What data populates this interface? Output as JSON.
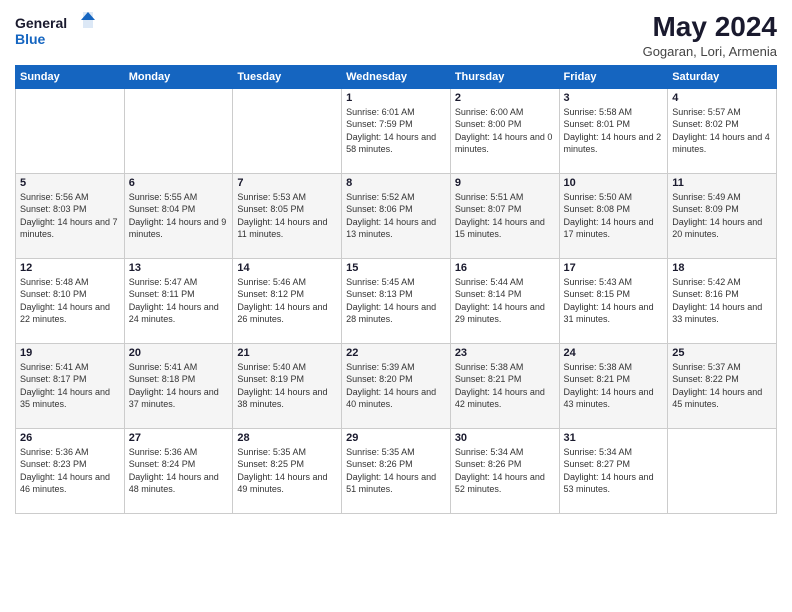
{
  "logo": {
    "line1": "General",
    "line2": "Blue"
  },
  "title": "May 2024",
  "subtitle": "Gogaran, Lori, Armenia",
  "weekdays": [
    "Sunday",
    "Monday",
    "Tuesday",
    "Wednesday",
    "Thursday",
    "Friday",
    "Saturday"
  ],
  "weeks": [
    [
      {
        "day": "",
        "sunrise": "",
        "sunset": "",
        "daylight": ""
      },
      {
        "day": "",
        "sunrise": "",
        "sunset": "",
        "daylight": ""
      },
      {
        "day": "",
        "sunrise": "",
        "sunset": "",
        "daylight": ""
      },
      {
        "day": "1",
        "sunrise": "Sunrise: 6:01 AM",
        "sunset": "Sunset: 7:59 PM",
        "daylight": "Daylight: 14 hours and 58 minutes."
      },
      {
        "day": "2",
        "sunrise": "Sunrise: 6:00 AM",
        "sunset": "Sunset: 8:00 PM",
        "daylight": "Daylight: 14 hours and 0 minutes."
      },
      {
        "day": "3",
        "sunrise": "Sunrise: 5:58 AM",
        "sunset": "Sunset: 8:01 PM",
        "daylight": "Daylight: 14 hours and 2 minutes."
      },
      {
        "day": "4",
        "sunrise": "Sunrise: 5:57 AM",
        "sunset": "Sunset: 8:02 PM",
        "daylight": "Daylight: 14 hours and 4 minutes."
      }
    ],
    [
      {
        "day": "5",
        "sunrise": "Sunrise: 5:56 AM",
        "sunset": "Sunset: 8:03 PM",
        "daylight": "Daylight: 14 hours and 7 minutes."
      },
      {
        "day": "6",
        "sunrise": "Sunrise: 5:55 AM",
        "sunset": "Sunset: 8:04 PM",
        "daylight": "Daylight: 14 hours and 9 minutes."
      },
      {
        "day": "7",
        "sunrise": "Sunrise: 5:53 AM",
        "sunset": "Sunset: 8:05 PM",
        "daylight": "Daylight: 14 hours and 11 minutes."
      },
      {
        "day": "8",
        "sunrise": "Sunrise: 5:52 AM",
        "sunset": "Sunset: 8:06 PM",
        "daylight": "Daylight: 14 hours and 13 minutes."
      },
      {
        "day": "9",
        "sunrise": "Sunrise: 5:51 AM",
        "sunset": "Sunset: 8:07 PM",
        "daylight": "Daylight: 14 hours and 15 minutes."
      },
      {
        "day": "10",
        "sunrise": "Sunrise: 5:50 AM",
        "sunset": "Sunset: 8:08 PM",
        "daylight": "Daylight: 14 hours and 17 minutes."
      },
      {
        "day": "11",
        "sunrise": "Sunrise: 5:49 AM",
        "sunset": "Sunset: 8:09 PM",
        "daylight": "Daylight: 14 hours and 20 minutes."
      }
    ],
    [
      {
        "day": "12",
        "sunrise": "Sunrise: 5:48 AM",
        "sunset": "Sunset: 8:10 PM",
        "daylight": "Daylight: 14 hours and 22 minutes."
      },
      {
        "day": "13",
        "sunrise": "Sunrise: 5:47 AM",
        "sunset": "Sunset: 8:11 PM",
        "daylight": "Daylight: 14 hours and 24 minutes."
      },
      {
        "day": "14",
        "sunrise": "Sunrise: 5:46 AM",
        "sunset": "Sunset: 8:12 PM",
        "daylight": "Daylight: 14 hours and 26 minutes."
      },
      {
        "day": "15",
        "sunrise": "Sunrise: 5:45 AM",
        "sunset": "Sunset: 8:13 PM",
        "daylight": "Daylight: 14 hours and 28 minutes."
      },
      {
        "day": "16",
        "sunrise": "Sunrise: 5:44 AM",
        "sunset": "Sunset: 8:14 PM",
        "daylight": "Daylight: 14 hours and 29 minutes."
      },
      {
        "day": "17",
        "sunrise": "Sunrise: 5:43 AM",
        "sunset": "Sunset: 8:15 PM",
        "daylight": "Daylight: 14 hours and 31 minutes."
      },
      {
        "day": "18",
        "sunrise": "Sunrise: 5:42 AM",
        "sunset": "Sunset: 8:16 PM",
        "daylight": "Daylight: 14 hours and 33 minutes."
      }
    ],
    [
      {
        "day": "19",
        "sunrise": "Sunrise: 5:41 AM",
        "sunset": "Sunset: 8:17 PM",
        "daylight": "Daylight: 14 hours and 35 minutes."
      },
      {
        "day": "20",
        "sunrise": "Sunrise: 5:41 AM",
        "sunset": "Sunset: 8:18 PM",
        "daylight": "Daylight: 14 hours and 37 minutes."
      },
      {
        "day": "21",
        "sunrise": "Sunrise: 5:40 AM",
        "sunset": "Sunset: 8:19 PM",
        "daylight": "Daylight: 14 hours and 38 minutes."
      },
      {
        "day": "22",
        "sunrise": "Sunrise: 5:39 AM",
        "sunset": "Sunset: 8:20 PM",
        "daylight": "Daylight: 14 hours and 40 minutes."
      },
      {
        "day": "23",
        "sunrise": "Sunrise: 5:38 AM",
        "sunset": "Sunset: 8:21 PM",
        "daylight": "Daylight: 14 hours and 42 minutes."
      },
      {
        "day": "24",
        "sunrise": "Sunrise: 5:38 AM",
        "sunset": "Sunset: 8:21 PM",
        "daylight": "Daylight: 14 hours and 43 minutes."
      },
      {
        "day": "25",
        "sunrise": "Sunrise: 5:37 AM",
        "sunset": "Sunset: 8:22 PM",
        "daylight": "Daylight: 14 hours and 45 minutes."
      }
    ],
    [
      {
        "day": "26",
        "sunrise": "Sunrise: 5:36 AM",
        "sunset": "Sunset: 8:23 PM",
        "daylight": "Daylight: 14 hours and 46 minutes."
      },
      {
        "day": "27",
        "sunrise": "Sunrise: 5:36 AM",
        "sunset": "Sunset: 8:24 PM",
        "daylight": "Daylight: 14 hours and 48 minutes."
      },
      {
        "day": "28",
        "sunrise": "Sunrise: 5:35 AM",
        "sunset": "Sunset: 8:25 PM",
        "daylight": "Daylight: 14 hours and 49 minutes."
      },
      {
        "day": "29",
        "sunrise": "Sunrise: 5:35 AM",
        "sunset": "Sunset: 8:26 PM",
        "daylight": "Daylight: 14 hours and 51 minutes."
      },
      {
        "day": "30",
        "sunrise": "Sunrise: 5:34 AM",
        "sunset": "Sunset: 8:26 PM",
        "daylight": "Daylight: 14 hours and 52 minutes."
      },
      {
        "day": "31",
        "sunrise": "Sunrise: 5:34 AM",
        "sunset": "Sunset: 8:27 PM",
        "daylight": "Daylight: 14 hours and 53 minutes."
      },
      {
        "day": "",
        "sunrise": "",
        "sunset": "",
        "daylight": ""
      }
    ]
  ]
}
